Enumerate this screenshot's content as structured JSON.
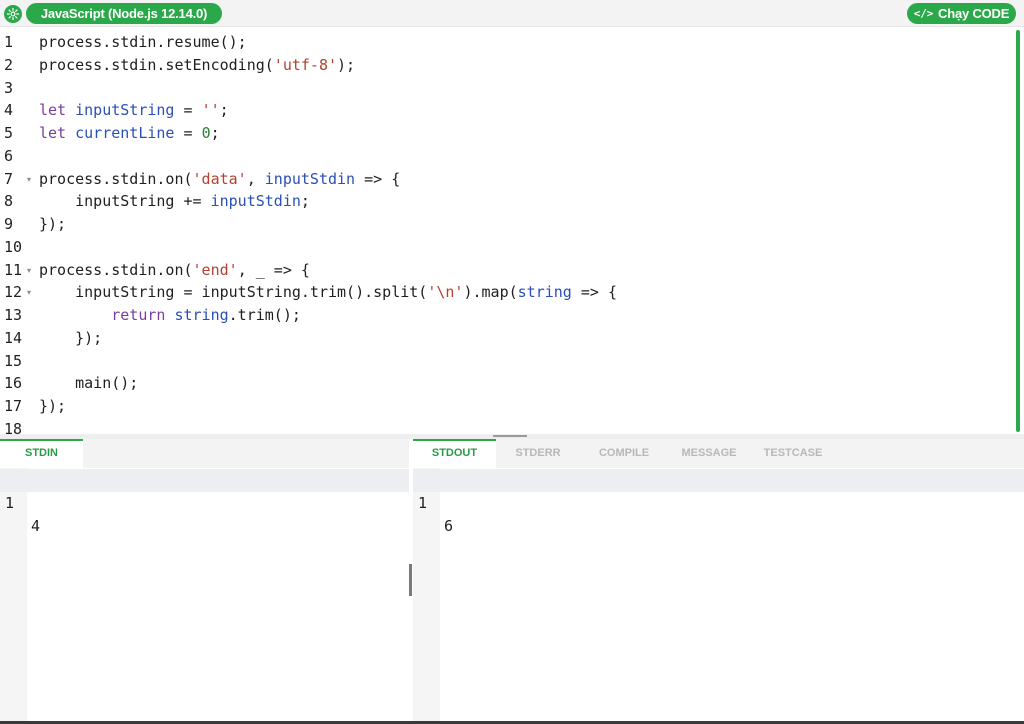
{
  "header": {
    "language_label": "JavaScript (Node.js 12.14.0)",
    "run_label": "Chạy CODE",
    "run_icon_glyph": "</>"
  },
  "editor": {
    "lines": [
      {
        "n": "1",
        "fold": "",
        "indent": "",
        "tokens": [
          [
            "def",
            "process.stdin.resume();"
          ]
        ]
      },
      {
        "n": "2",
        "fold": "",
        "indent": "",
        "tokens": [
          [
            "def",
            "process.stdin.setEncoding("
          ],
          [
            "str",
            "'utf-8'"
          ],
          [
            "def",
            ");"
          ]
        ]
      },
      {
        "n": "3",
        "fold": "",
        "indent": "",
        "tokens": []
      },
      {
        "n": "4",
        "fold": "",
        "indent": "",
        "tokens": [
          [
            "kw",
            "let "
          ],
          [
            "var",
            "inputString"
          ],
          [
            "def",
            " = "
          ],
          [
            "str",
            "''"
          ],
          [
            "def",
            ";"
          ]
        ]
      },
      {
        "n": "5",
        "fold": "",
        "indent": "",
        "tokens": [
          [
            "kw",
            "let "
          ],
          [
            "var",
            "currentLine"
          ],
          [
            "def",
            " = "
          ],
          [
            "num",
            "0"
          ],
          [
            "def",
            ";"
          ]
        ]
      },
      {
        "n": "6",
        "fold": "",
        "indent": "",
        "tokens": []
      },
      {
        "n": "7",
        "fold": "▾",
        "indent": "",
        "tokens": [
          [
            "def",
            "process.stdin.on("
          ],
          [
            "str",
            "'data'"
          ],
          [
            "def",
            ", "
          ],
          [
            "var",
            "inputStdin"
          ],
          [
            "def",
            " => {"
          ]
        ]
      },
      {
        "n": "8",
        "fold": "",
        "indent": "    ",
        "tokens": [
          [
            "def",
            "inputString += "
          ],
          [
            "var",
            "inputStdin"
          ],
          [
            "def",
            ";"
          ]
        ]
      },
      {
        "n": "9",
        "fold": "",
        "indent": "",
        "tokens": [
          [
            "def",
            "});"
          ]
        ]
      },
      {
        "n": "10",
        "fold": "",
        "indent": "",
        "tokens": []
      },
      {
        "n": "11",
        "fold": "▾",
        "indent": "",
        "tokens": [
          [
            "def",
            "process.stdin.on("
          ],
          [
            "str",
            "'end'"
          ],
          [
            "def",
            ", _ => {"
          ]
        ]
      },
      {
        "n": "12",
        "fold": "▾",
        "indent": "    ",
        "tokens": [
          [
            "def",
            "inputString = inputString.trim().split("
          ],
          [
            "str",
            "'\\n'"
          ],
          [
            "def",
            ").map("
          ],
          [
            "var",
            "string"
          ],
          [
            "def",
            " => {"
          ]
        ]
      },
      {
        "n": "13",
        "fold": "",
        "indent": "        ",
        "tokens": [
          [
            "kw",
            "return "
          ],
          [
            "var",
            "string"
          ],
          [
            "def",
            ".trim();"
          ]
        ]
      },
      {
        "n": "14",
        "fold": "",
        "indent": "    ",
        "tokens": [
          [
            "def",
            "});"
          ]
        ]
      },
      {
        "n": "15",
        "fold": "",
        "indent": "",
        "tokens": []
      },
      {
        "n": "16",
        "fold": "",
        "indent": "    ",
        "tokens": [
          [
            "def",
            "main();"
          ]
        ]
      },
      {
        "n": "17",
        "fold": "",
        "indent": "",
        "tokens": [
          [
            "def",
            "});"
          ]
        ]
      },
      {
        "n": "18",
        "fold": "",
        "indent": "",
        "tokens": []
      }
    ]
  },
  "stdin": {
    "tab_label": "STDIN",
    "line_number": "1",
    "value": "4"
  },
  "output": {
    "tabs": [
      "STDOUT",
      "STDERR",
      "COMPILE",
      "MESSAGE",
      "TESTCASE"
    ],
    "active_tab": "STDOUT",
    "line_number": "1",
    "value": "6"
  },
  "colors": {
    "accent": "#2aa84a",
    "keyword": "#7a3e9d",
    "variable": "#2a4fb8",
    "string": "#b3412f",
    "number": "#2c7d3a"
  }
}
